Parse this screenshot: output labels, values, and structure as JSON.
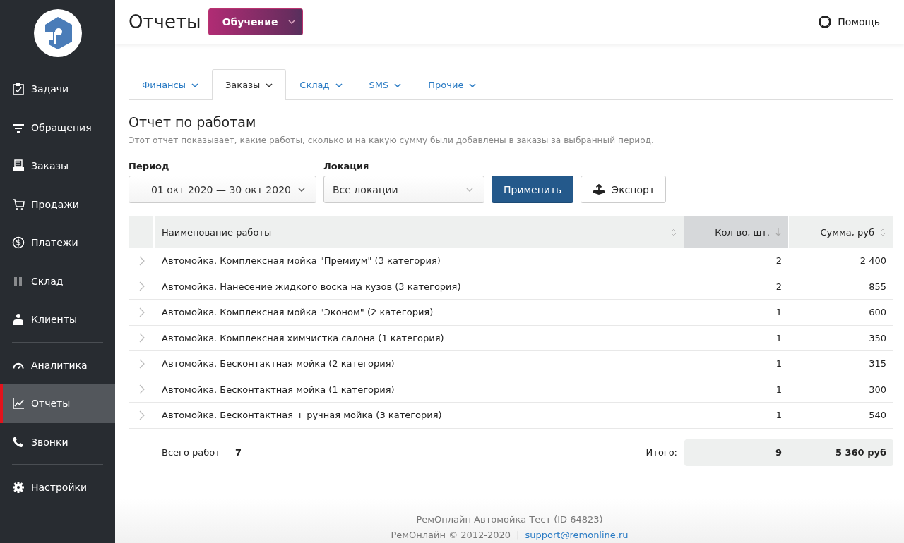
{
  "sidebar": {
    "groups": [
      {
        "items": [
          {
            "label": "Задачи",
            "selected": false
          },
          {
            "label": "Обращения",
            "selected": false
          },
          {
            "label": "Заказы",
            "selected": false
          },
          {
            "label": "Продажи",
            "selected": false
          },
          {
            "label": "Платежи",
            "selected": false
          },
          {
            "label": "Склад",
            "selected": false
          },
          {
            "label": "Клиенты",
            "selected": false
          }
        ]
      },
      {
        "items": [
          {
            "label": "Аналитика",
            "selected": false
          },
          {
            "label": "Отчеты",
            "selected": true
          },
          {
            "label": "Звонки",
            "selected": false
          }
        ]
      },
      {
        "items": [
          {
            "label": "Настройки",
            "selected": false
          }
        ]
      }
    ]
  },
  "header": {
    "title": "Отчеты",
    "training_button": "Обучение",
    "help": "Помощь"
  },
  "tabs": [
    {
      "label": "Финансы",
      "selected": false
    },
    {
      "label": "Заказы",
      "selected": true
    },
    {
      "label": "Склад",
      "selected": false
    },
    {
      "label": "SMS",
      "selected": false
    },
    {
      "label": "Прочие",
      "selected": false
    }
  ],
  "report": {
    "title": "Отчет по работам",
    "description": "Этот отчет показывает, какие работы, сколько и на какую сумму были добавлены в заказы за выбранный период."
  },
  "filters": {
    "period_label": "Период",
    "period_value": "01 окт 2020 — 30 окт 2020",
    "location_label": "Локация",
    "location_value": "Все локации",
    "apply_button": "Применить",
    "export_button": "Экспорт"
  },
  "table": {
    "columns": [
      {
        "label": "Наименование работы",
        "sorted": false
      },
      {
        "label": "Кол-во, шт.",
        "sorted": true
      },
      {
        "label": "Сумма, руб",
        "sorted": false
      }
    ],
    "rows": [
      [
        "Автомойка. Комплексная мойка \"Премиум\" (3 категория)",
        "2",
        "2 400"
      ],
      [
        "Автомойка. Нанесение жидкого воска на кузов (3 категория)",
        "2",
        "855"
      ],
      [
        "Автомойка. Комплексная мойка \"Эконом\" (2 категория)",
        "1",
        "600"
      ],
      [
        "Автомойка. Комплексная химчистка салона (1 категория)",
        "1",
        "350"
      ],
      [
        "Автомойка. Бесконтактная мойка (2 категория)",
        "1",
        "315"
      ],
      [
        "Автомойка. Бесконтактная мойка (1 категория)",
        "1",
        "300"
      ],
      [
        "Автомойка. Бесконтактная + ручная мойка (3 категория)",
        "1",
        "540"
      ]
    ],
    "total_count": "Всего работ — **7**",
    "total_label": "Итого:",
    "total_qty": "9",
    "total_sum": "5 360 руб"
  },
  "footer": {
    "company": "РемОнлайн Автомойка Тест (ID 64823)",
    "copyright": "РемОнлайн © 2012-2020",
    "separator": "|",
    "email": "support@remonline.ru"
  }
}
